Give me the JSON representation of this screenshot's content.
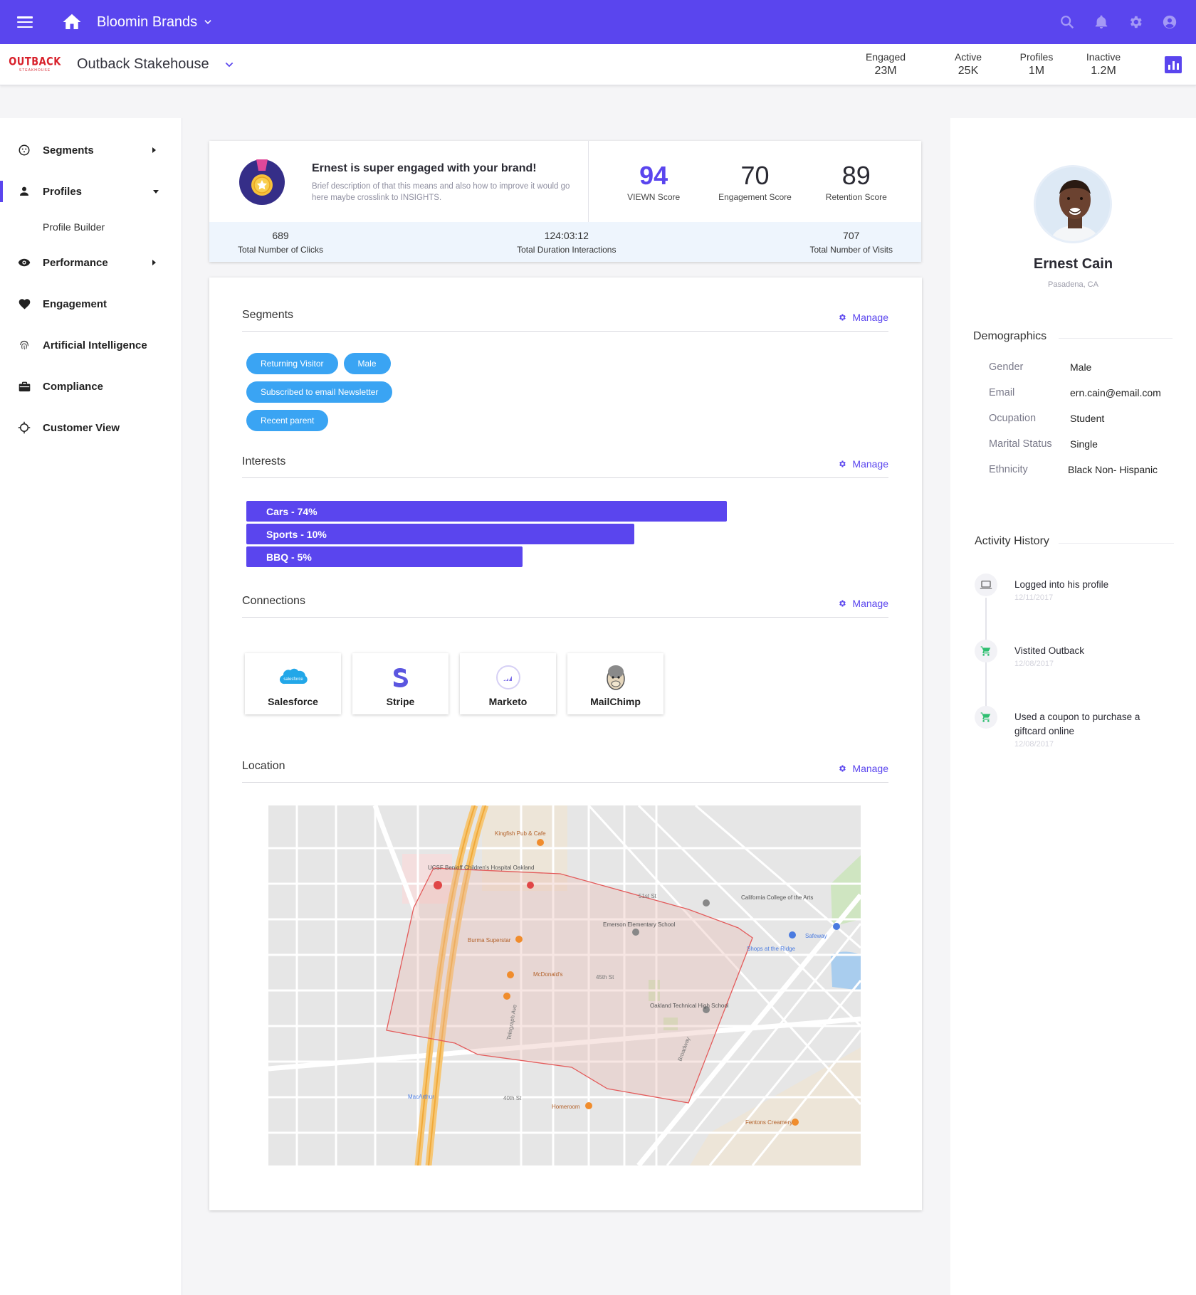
{
  "topbar": {
    "brand": "Bloomin Brands"
  },
  "subheader": {
    "logo_text": "OUTBACK",
    "logo_subtext": "STEAKHOUSE",
    "store": "Outback Stakehouse",
    "stats": [
      {
        "label": "Engaged",
        "value": "23M"
      },
      {
        "label": "Active",
        "value": "25K"
      },
      {
        "label": "Profiles",
        "value": "1M"
      },
      {
        "label": "Inactive",
        "value": "1.2M"
      }
    ]
  },
  "sidebar": {
    "items": [
      {
        "label": "Segments"
      },
      {
        "label": "Profiles"
      },
      {
        "label": "Profile Builder"
      },
      {
        "label": "Performance"
      },
      {
        "label": "Engagement"
      },
      {
        "label": "Artificial Intelligence"
      },
      {
        "label": "Compliance"
      },
      {
        "label": "Customer View"
      }
    ]
  },
  "summary": {
    "headline": "Ernest is super engaged with your brand!",
    "description": "Brief description of that this means and also how to improve it would go here maybe crosslink to INSIGHTS.",
    "scores": [
      {
        "value": "94",
        "label": "VIEWN Score"
      },
      {
        "value": "70",
        "label": "Engagement Score"
      },
      {
        "value": "89",
        "label": "Retention Score"
      }
    ],
    "totals": [
      {
        "value": "689",
        "label": "Total Number of Clicks"
      },
      {
        "value": "124:03:12",
        "label": "Total Duration Interactions"
      },
      {
        "value": "707",
        "label": "Total Number of Visits"
      }
    ]
  },
  "details": {
    "manage_label": "Manage",
    "segments_title": "Segments",
    "segments": [
      "Returning Visitor",
      "Male",
      "Subscribed to email Newsletter",
      "Recent parent"
    ],
    "interests_title": "Interests",
    "interests": [
      {
        "label": "Cars - 74%",
        "value": 74
      },
      {
        "label": "Sports - 10%",
        "value": 10
      },
      {
        "label": "BBQ - 5%",
        "value": 5
      }
    ],
    "connections_title": "Connections",
    "connections": [
      "Salesforce",
      "Stripe",
      "Marketo",
      "MailChimp"
    ],
    "salesforce_logo_text": "salesforce",
    "location_title": "Location",
    "map_labels": {
      "ucsf": "UCSF Benioff Children's Hospital Oakland",
      "kingfish": "Kingfish Pub & Cafe",
      "burma": "Burma Superstar",
      "emerson": "Emerson Elementary School",
      "mcdonalds": "McDonald's",
      "cca": "California College of the Arts",
      "safeway": "Safeway",
      "shops": "Shops at the Ridge",
      "oakland_tech": "Oakland Technical High School",
      "macarthur": "MacArthur",
      "homeroom": "Homeroom",
      "fentons": "Fentons Creamery",
      "st51": "51st St",
      "st45": "45th St",
      "st40": "40th St",
      "telegraph": "Telegraph Ave",
      "broadway": "Broadway"
    }
  },
  "profile": {
    "name": "Ernest Cain",
    "location": "Pasadena, CA",
    "demographics_title": "Demographics",
    "demographics": [
      {
        "key": "Gender",
        "value": "Male"
      },
      {
        "key": "Email",
        "value": "ern.cain@email.com"
      },
      {
        "key": "Ocupation",
        "value": "Student"
      },
      {
        "key": "Marital Status",
        "value": "Single"
      },
      {
        "key": "Ethnicity",
        "value": "Black Non- Hispanic"
      }
    ],
    "activity_title": "Activity History",
    "activity": [
      {
        "text": "Logged into his profile",
        "date": "12/11/2017"
      },
      {
        "text": "Vistited Outback",
        "date": "12/08/2017"
      },
      {
        "text": "Used a coupon to purchase a giftcard online",
        "date": "12/08/2017"
      }
    ]
  },
  "colors": {
    "accent": "#5a45ee",
    "chip": "#3aa4f3",
    "score_band": "#eef5fd",
    "activity_icon": "#2fbf71"
  }
}
